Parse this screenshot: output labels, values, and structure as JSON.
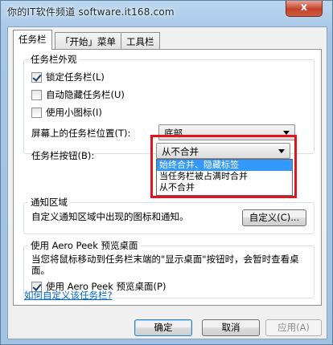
{
  "window": {
    "title": "你的IT软件频道 software.it168.com",
    "close_glyph": "x"
  },
  "tabs": [
    {
      "label": "任务栏"
    },
    {
      "label": "「开始」菜单"
    },
    {
      "label": "工具栏"
    }
  ],
  "appearance": {
    "title": "任务栏外观",
    "lock_taskbar": {
      "label": "锁定任务栏(L)",
      "checked": true
    },
    "auto_hide": {
      "label": "自动隐藏任务栏(U)",
      "checked": false
    },
    "small_icons": {
      "label": "使用小图标(I)",
      "checked": false
    },
    "position_label": "屏幕上的任务栏位置(T):",
    "position_value": "底部",
    "buttons_label": "任务栏按钮(B):",
    "buttons_value": "从不合并",
    "buttons_options": [
      {
        "label": "始终合并、隐藏标签",
        "selected": true
      },
      {
        "label": "当任务栏被占满时合并",
        "selected": false
      },
      {
        "label": "从不合并",
        "selected": false
      }
    ]
  },
  "notification": {
    "title": "通知区域",
    "text": "自定义通知区域中出现的图标和通知。",
    "customize_button": "自定义(C)..."
  },
  "aero_peek": {
    "title": "使用 Aero Peek 预览桌面",
    "description": "当您将鼠标移动到任务栏末端的\"显示桌面\"按钮时，会暂时查看桌面。",
    "checkbox": {
      "label": "使用 Aero Peek 预览桌面(P)",
      "checked": true
    }
  },
  "help_link": "如何自定义该任务栏?",
  "footer": {
    "ok": "确定",
    "cancel": "取消",
    "apply": "应用(A)"
  }
}
